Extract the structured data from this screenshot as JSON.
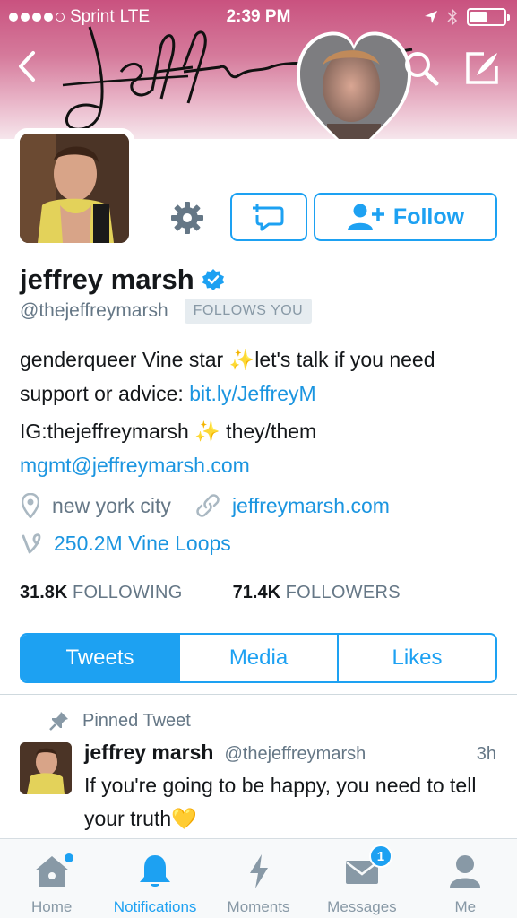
{
  "status_bar": {
    "carrier": "Sprint",
    "network": "LTE",
    "time": "2:39 PM"
  },
  "profile": {
    "name": "jeffrey marsh",
    "handle": "@thejeffreymarsh",
    "follows_you": "FOLLOWS YOU",
    "follow_label": "Follow",
    "bio": {
      "line1_text": "genderqueer Vine star ",
      "line1_sparkle": "✨",
      "line1_rest": "let's talk if you need",
      "line2_text": "support or advice: ",
      "line2_link": "bit.ly/JeffreyM",
      "line3_text": "IG:thejeffreymarsh ",
      "line3_sparkle": "✨",
      "line3_rest": " they/them",
      "line4_link": "mgmt@jeffreymarsh.com"
    },
    "location": "new york city",
    "website": "jeffreymarsh.com",
    "vine_loops": "250.2M Vine Loops",
    "following_count": "31.8K",
    "following_label": "FOLLOWING",
    "followers_count": "71.4K",
    "followers_label": "FOLLOWERS"
  },
  "segments": {
    "tweets": "Tweets",
    "media": "Media",
    "likes": "Likes",
    "active": "Tweets"
  },
  "pinned_tweet": {
    "label": "Pinned Tweet",
    "name": "jeffrey marsh",
    "handle": "@thejeffreymarsh",
    "time": "3h",
    "text": "If you're going to be happy, you need to tell your truth",
    "emoji": "💛"
  },
  "tabbar": {
    "home": "Home",
    "notifications": "Notifications",
    "moments": "Moments",
    "messages": "Messages",
    "messages_badge": "1",
    "me": "Me",
    "active": "Notifications"
  },
  "colors": {
    "accent": "#1da1f2",
    "link": "#1b95e0",
    "secondary_text": "#657786",
    "header_top": "#c9527f"
  },
  "icons": {
    "back": "chevron-left-icon",
    "search": "search-icon",
    "compose": "compose-icon",
    "settings": "gear-icon",
    "message": "direct-message-icon",
    "follow": "add-user-icon",
    "verified": "verified-badge-icon",
    "location": "location-pin-icon",
    "link": "link-icon",
    "vine": "vine-icon",
    "pin": "pin-icon"
  }
}
